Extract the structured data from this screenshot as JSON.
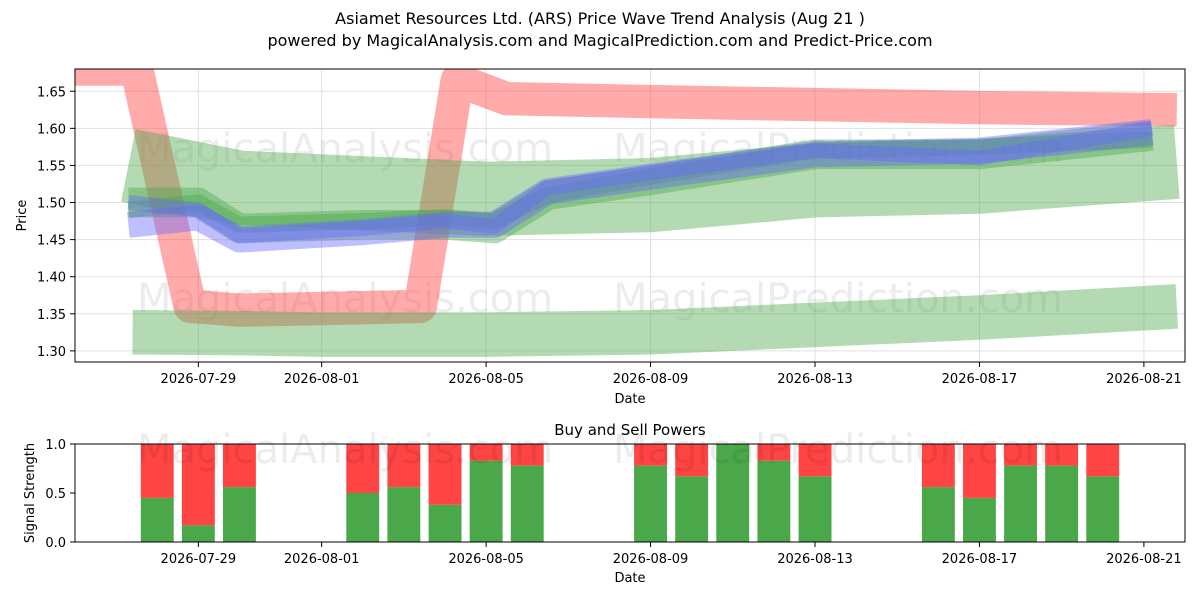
{
  "title": "Asiamet Resources Ltd. (ARS) Price Wave Trend Analysis (Aug 21 )",
  "subtitle": "powered by MagicalAnalysis.com and MagicalPrediction.com and Predict-Price.com",
  "watermarks": [
    "MagicalAnalysis.com",
    "MagicalPrediction.com"
  ],
  "colors": {
    "red": "#ff4444",
    "green": "#4aa84a",
    "blue": "#6666ff",
    "grid": "#e0e0e0"
  },
  "chart_data": [
    {
      "type": "area",
      "xlabel": "Date",
      "ylabel": "Price",
      "x_ticks": [
        "2026-07-29",
        "2026-08-01",
        "2026-08-05",
        "2026-08-09",
        "2026-08-13",
        "2026-08-17",
        "2026-08-21"
      ],
      "y_ticks": [
        "1.30",
        "1.35",
        "1.40",
        "1.45",
        "1.50",
        "1.55",
        "1.60",
        "1.65"
      ],
      "xlim": [
        "2026-07-26",
        "2026-08-22"
      ],
      "ylim": [
        1.285,
        1.68
      ],
      "grid": true,
      "bands": [
        {
          "color": "red",
          "width": 0.045,
          "x": [
            "2026-07-26",
            "2026-07-27.5",
            "2026-07-28.8",
            "2026-07-30",
            "2026-08-01",
            "2026-08-03.4",
            "2026-08-04.3",
            "2026-08-05.5",
            "2026-08-09",
            "2026-08-13",
            "2026-08-17",
            "2026-08-21.8"
          ],
          "y": [
            1.68,
            1.68,
            1.36,
            1.355,
            1.357,
            1.36,
            1.665,
            1.64,
            1.636,
            1.632,
            1.628,
            1.625
          ]
        },
        {
          "color": "green",
          "width": 0.06,
          "x": [
            "2026-07-27.4",
            "2026-07-30",
            "2026-08-01",
            "2026-08-05",
            "2026-08-09",
            "2026-08-13",
            "2026-08-17",
            "2026-08-21.8"
          ],
          "y": [
            1.325,
            1.324,
            1.322,
            1.322,
            1.325,
            1.335,
            1.345,
            1.36
          ]
        },
        {
          "color": "green",
          "width": 0.1,
          "x": [
            "2026-07-27.3",
            "2026-07-30",
            "2026-08-01",
            "2026-08-05",
            "2026-08-09",
            "2026-08-13",
            "2026-08-17",
            "2026-08-21.8"
          ],
          "y": [
            1.55,
            1.52,
            1.515,
            1.505,
            1.51,
            1.53,
            1.535,
            1.555
          ]
        },
        {
          "color": "green",
          "width": 0.04,
          "x": [
            "2026-07-27.3",
            "2026-07-29",
            "2026-07-30",
            "2026-08-02",
            "2026-08-04",
            "2026-08-05.2",
            "2026-08-06.5",
            "2026-08-09",
            "2026-08-13",
            "2026-08-17",
            "2026-08-21.2"
          ],
          "y": [
            1.5,
            1.5,
            1.465,
            1.47,
            1.47,
            1.465,
            1.51,
            1.53,
            1.565,
            1.565,
            1.59
          ]
        },
        {
          "color": "green",
          "width": 0.022,
          "x": [
            "2026-07-27.3",
            "2026-07-29",
            "2026-07-30",
            "2026-08-02",
            "2026-08-04",
            "2026-08-05.2",
            "2026-08-06.5",
            "2026-08-09",
            "2026-08-13",
            "2026-08-17",
            "2026-08-21.2"
          ],
          "y": [
            1.49,
            1.5,
            1.47,
            1.475,
            1.48,
            1.475,
            1.51,
            1.535,
            1.57,
            1.575,
            1.585
          ]
        },
        {
          "color": "blue",
          "width": 0.035,
          "x": [
            "2026-07-27.3",
            "2026-07-29",
            "2026-07-30",
            "2026-08-02",
            "2026-08-04",
            "2026-08-05.2",
            "2026-08-06.5",
            "2026-08-09",
            "2026-08-13",
            "2026-08-17",
            "2026-08-21.2"
          ],
          "y": [
            1.47,
            1.48,
            1.45,
            1.46,
            1.47,
            1.47,
            1.515,
            1.535,
            1.565,
            1.57,
            1.595
          ]
        },
        {
          "color": "blue",
          "width": 0.02,
          "x": [
            "2026-07-27.3",
            "2026-07-29",
            "2026-07-30",
            "2026-08-02",
            "2026-08-04",
            "2026-08-05.2",
            "2026-08-06.5",
            "2026-08-09",
            "2026-08-13",
            "2026-08-17",
            "2026-08-21.2"
          ],
          "y": [
            1.5,
            1.49,
            1.455,
            1.465,
            1.475,
            1.468,
            1.52,
            1.54,
            1.57,
            1.56,
            1.6
          ]
        }
      ]
    },
    {
      "type": "bar",
      "title": "Buy and Sell Powers",
      "xlabel": "Date",
      "ylabel": "Signal Strength",
      "x_ticks": [
        "2026-07-29",
        "2026-08-01",
        "2026-08-05",
        "2026-08-09",
        "2026-08-13",
        "2026-08-17",
        "2026-08-21"
      ],
      "y_ticks": [
        "0.0",
        "0.5",
        "1.0"
      ],
      "xlim": [
        "2026-07-26",
        "2026-08-22"
      ],
      "ylim": [
        0,
        1
      ],
      "categories": [
        "2026-07-28",
        "2026-07-29",
        "2026-07-30",
        "2026-08-02",
        "2026-08-03",
        "2026-08-04",
        "2026-08-05",
        "2026-08-06",
        "2026-08-09",
        "2026-08-10",
        "2026-08-11",
        "2026-08-12",
        "2026-08-13",
        "2026-08-16",
        "2026-08-17",
        "2026-08-18",
        "2026-08-19",
        "2026-08-20"
      ],
      "series": [
        {
          "color": "green",
          "values": [
            0.45,
            0.17,
            0.56,
            0.5,
            0.56,
            0.38,
            0.83,
            0.78,
            0.78,
            0.67,
            1.0,
            0.83,
            0.67,
            0.56,
            0.45,
            0.78,
            0.78,
            0.67
          ]
        },
        {
          "color": "red",
          "values": [
            0.55,
            0.83,
            0.44,
            0.5,
            0.44,
            0.62,
            0.17,
            0.22,
            0.22,
            0.33,
            0.0,
            0.17,
            0.33,
            0.44,
            0.55,
            0.22,
            0.22,
            0.33
          ]
        }
      ]
    }
  ]
}
